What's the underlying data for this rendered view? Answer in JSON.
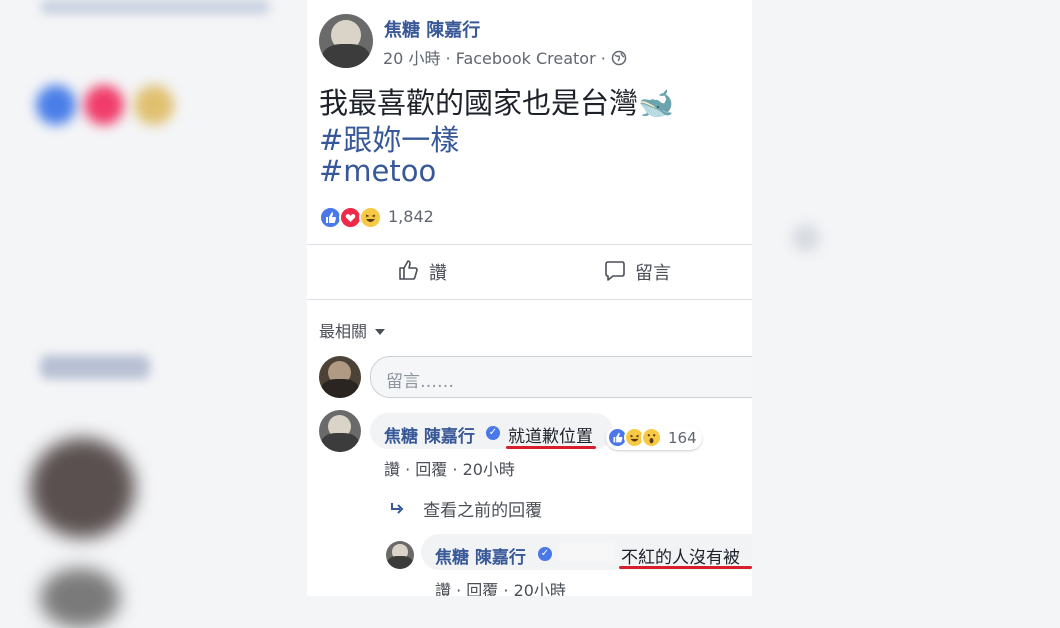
{
  "post": {
    "author": "焦糖 陳嘉行",
    "time_source": "20 小時 · Facebook Creator · ",
    "text": "我最喜歡的國家也是台灣🐋",
    "hashtag1": "#跟妳一樣",
    "hashtag2": "#metoo",
    "reaction_count": "1,842"
  },
  "actions": {
    "like_label": "讚",
    "comment_label": "留言"
  },
  "sort_label": "最相關",
  "comment_input": {
    "placeholder": "留言……"
  },
  "comments": [
    {
      "author": "焦糖 陳嘉行",
      "text": "就道歉位置",
      "reaction_count": "164",
      "like_label": "讚",
      "reply_label": "回覆",
      "time": "20小時"
    }
  ],
  "view_previous_replies": "查看之前的回覆",
  "reply": {
    "author": "焦糖 陳嘉行",
    "text": "不紅的人沒有被",
    "like_label": "讚",
    "reply_label": "回覆",
    "time": "20小時"
  },
  "colors": {
    "link_blue": "#385898",
    "underline_red": "#d81e2c"
  }
}
